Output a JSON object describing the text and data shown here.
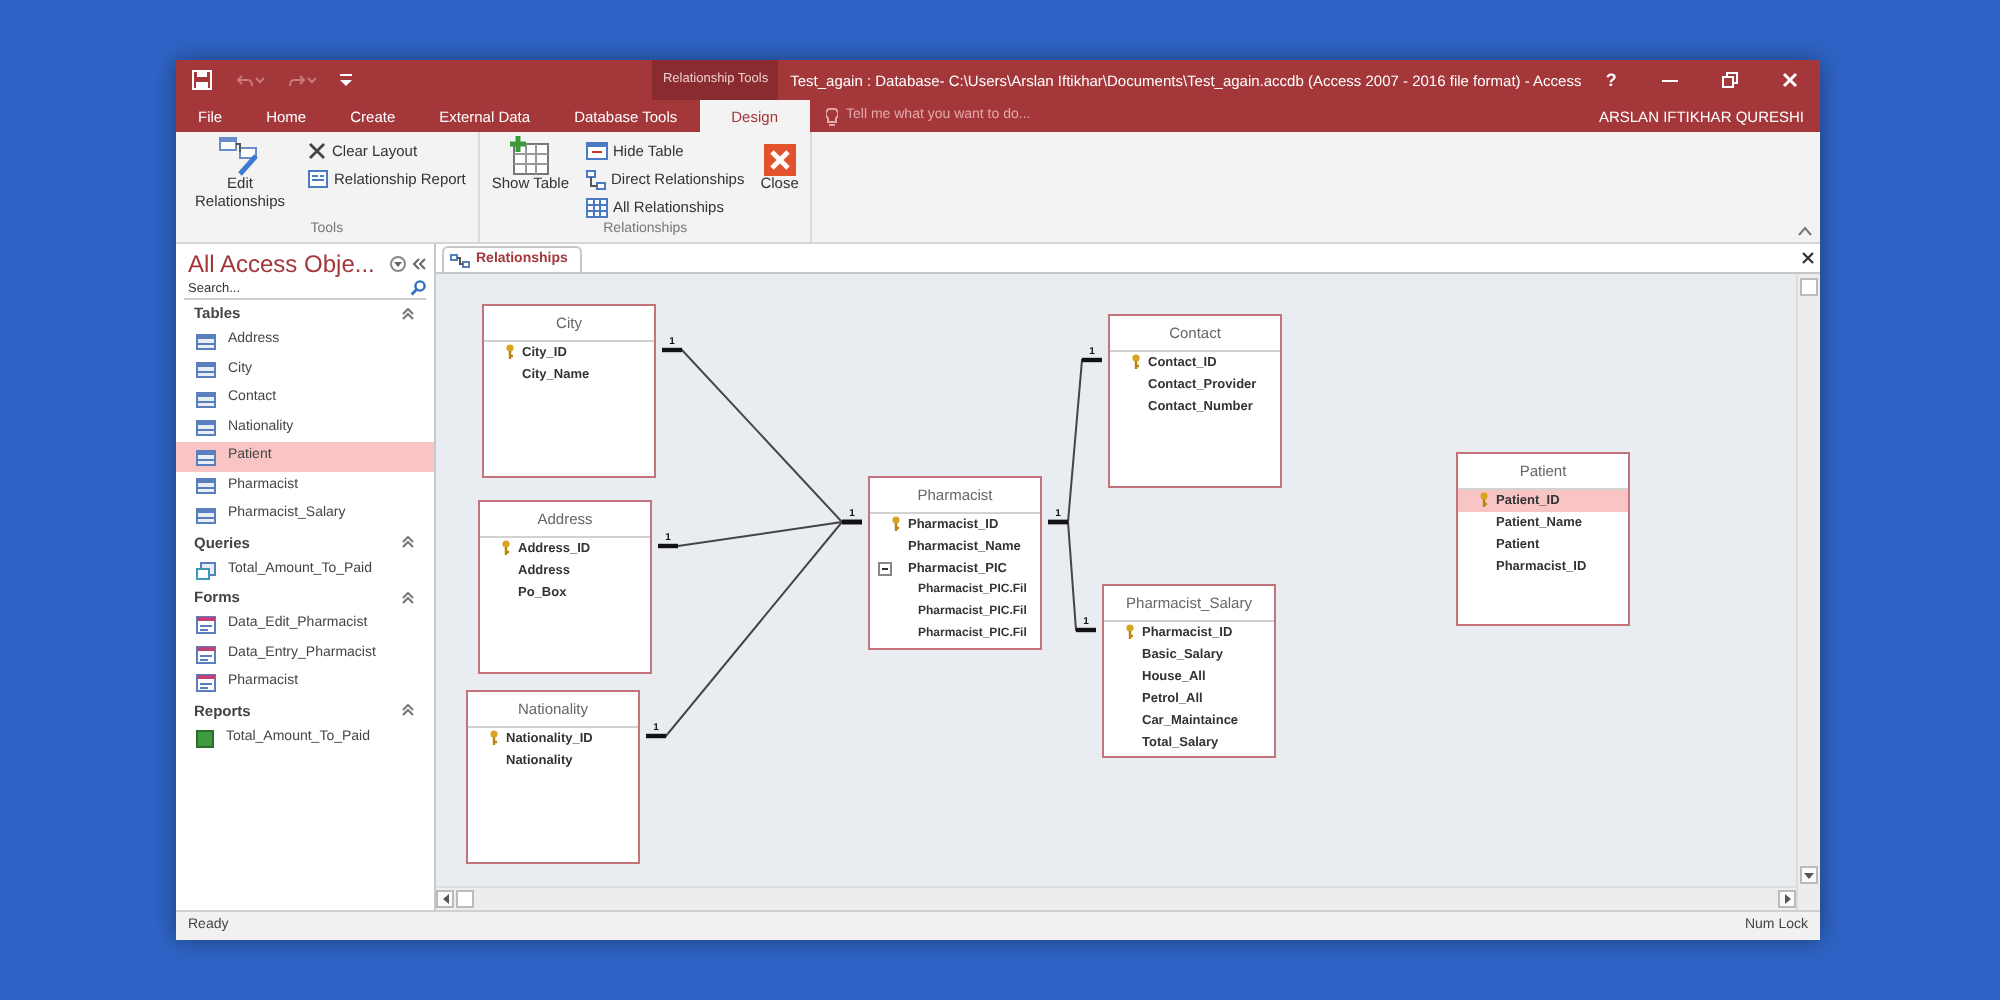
{
  "window": {
    "context_label": "Relationship Tools",
    "title": "Test_again : Database- C:\\Users\\Arslan Iftikhar\\Documents\\Test_again.accdb (Access 2007 - 2016 file format) - Access",
    "help": "?"
  },
  "ribbon_tabs": [
    {
      "label": "File",
      "selected": false
    },
    {
      "label": "Home",
      "selected": false
    },
    {
      "label": "Create",
      "selected": false
    },
    {
      "label": "External Data",
      "selected": false
    },
    {
      "label": "Database Tools",
      "selected": false
    },
    {
      "label": "Design",
      "selected": true
    }
  ],
  "tell_me": {
    "placeholder": "Tell me what you want to do..."
  },
  "user": "ARSLAN IFTIKHAR QURESHI",
  "ribbon_groups": [
    {
      "label": "Tools",
      "commands": [
        {
          "label": "Edit Relationships",
          "kind": "large"
        },
        {
          "label": "Clear Layout",
          "kind": "small"
        },
        {
          "label": "Relationship Report",
          "kind": "small"
        }
      ]
    },
    {
      "label": "Relationships",
      "commands": [
        {
          "label": "Show Table",
          "kind": "large"
        },
        {
          "label": "Hide Table",
          "kind": "small"
        },
        {
          "label": "Direct Relationships",
          "kind": "small"
        },
        {
          "label": "All Relationships",
          "kind": "small"
        },
        {
          "label": "Close",
          "kind": "large"
        }
      ]
    }
  ],
  "nav_pane": {
    "title": "All Access Obje...",
    "search": {
      "placeholder": "Search..."
    },
    "groups": [
      {
        "label": "Tables",
        "kind": "table",
        "expanded": true,
        "items": [
          {
            "label": "Address",
            "selected": false
          },
          {
            "label": "City",
            "selected": false
          },
          {
            "label": "Contact",
            "selected": false
          },
          {
            "label": "Nationality",
            "selected": false
          },
          {
            "label": "Patient",
            "selected": true
          },
          {
            "label": "Pharmacist",
            "selected": false
          },
          {
            "label": "Pharmacist_Salary",
            "selected": false
          }
        ]
      },
      {
        "label": "Queries",
        "kind": "query",
        "expanded": true,
        "items": [
          {
            "label": "Total_Amount_To_Paid",
            "selected": false
          }
        ]
      },
      {
        "label": "Forms",
        "kind": "form",
        "expanded": true,
        "items": [
          {
            "label": "Data_Edit_Pharmacist",
            "selected": false
          },
          {
            "label": "Data_Entry_Pharmacist",
            "selected": false
          },
          {
            "label": "Pharmacist",
            "selected": false
          }
        ]
      },
      {
        "label": "Reports",
        "kind": "report",
        "expanded": true,
        "items": [
          {
            "label": "Total_Amount_To_Paid",
            "selected": false
          }
        ]
      }
    ]
  },
  "document_tabs": [
    {
      "label": "Relationships",
      "selected": true
    }
  ],
  "tables": [
    {
      "title": "City",
      "fields": [
        {
          "name": "City_ID",
          "primary_key": true,
          "selected": false
        },
        {
          "name": "City_Name",
          "primary_key": false,
          "selected": false
        }
      ]
    },
    {
      "title": "Address",
      "fields": [
        {
          "name": "Address_ID",
          "primary_key": true,
          "selected": false
        },
        {
          "name": "Address",
          "primary_key": false,
          "selected": false
        },
        {
          "name": "Po_Box",
          "primary_key": false,
          "selected": false
        }
      ]
    },
    {
      "title": "Nationality",
      "fields": [
        {
          "name": "Nationality_ID",
          "primary_key": true,
          "selected": false
        },
        {
          "name": "Nationality",
          "primary_key": false,
          "selected": false
        }
      ]
    },
    {
      "title": "Pharmacist",
      "fields": [
        {
          "name": "Pharmacist_ID",
          "primary_key": true,
          "selected": false
        },
        {
          "name": "Pharmacist_Name",
          "primary_key": false,
          "selected": false
        },
        {
          "name": "Pharmacist_PIC",
          "primary_key": false,
          "selected": false,
          "expanded": true,
          "children": [
            {
              "name": "Pharmacist_PIC.Fil"
            },
            {
              "name": "Pharmacist_PIC.Fil"
            },
            {
              "name": "Pharmacist_PIC.Fil"
            }
          ]
        }
      ]
    },
    {
      "title": "Contact",
      "fields": [
        {
          "name": "Contact_ID",
          "primary_key": true,
          "selected": false
        },
        {
          "name": "Contact_Provider",
          "primary_key": false,
          "selected": false
        },
        {
          "name": "Contact_Number",
          "primary_key": false,
          "selected": false
        }
      ]
    },
    {
      "title": "Pharmacist_Salary",
      "fields": [
        {
          "name": "Pharmacist_ID",
          "primary_key": true,
          "selected": false
        },
        {
          "name": "Basic_Salary",
          "primary_key": false,
          "selected": false
        },
        {
          "name": "House_All",
          "primary_key": false,
          "selected": false
        },
        {
          "name": "Petrol_All",
          "primary_key": false,
          "selected": false
        },
        {
          "name": "Car_Maintaince",
          "primary_key": false,
          "selected": false
        },
        {
          "name": "Total_Salary",
          "primary_key": false,
          "selected": false
        }
      ]
    },
    {
      "title": "Patient",
      "fields": [
        {
          "name": "Patient_ID",
          "primary_key": true,
          "selected": true
        },
        {
          "name": "Patient_Name",
          "primary_key": false,
          "selected": false
        },
        {
          "name": "Patient",
          "primary_key": false,
          "selected": false
        },
        {
          "name": "Pharmacist_ID",
          "primary_key": false,
          "selected": false
        }
      ]
    }
  ],
  "relationships": [
    {
      "from_end": "1",
      "to_end": "1"
    },
    {
      "from_end": "1"
    },
    {
      "from_end": "1"
    },
    {
      "from_end": "1",
      "to_end": "1"
    },
    {
      "to_end": "1"
    }
  ],
  "status_bar": {
    "left": "Ready",
    "right": "Num Lock"
  }
}
